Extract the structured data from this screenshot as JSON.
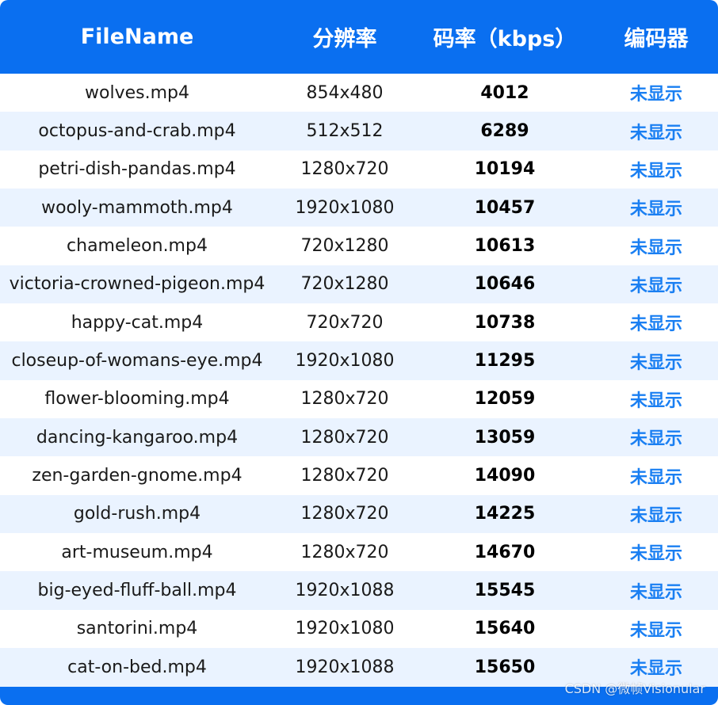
{
  "table": {
    "headers": [
      "FileName",
      "分辨率",
      "码率（kbps）",
      "编码器"
    ],
    "rows": [
      {
        "filename": "wolves.mp4",
        "resolution": "854x480",
        "bitrate": "4012",
        "codec": "未显示"
      },
      {
        "filename": "octopus-and-crab.mp4",
        "resolution": "512x512",
        "bitrate": "6289",
        "codec": "未显示"
      },
      {
        "filename": "petri-dish-pandas.mp4",
        "resolution": "1280x720",
        "bitrate": "10194",
        "codec": "未显示"
      },
      {
        "filename": "wooly-mammoth.mp4",
        "resolution": "1920x1080",
        "bitrate": "10457",
        "codec": "未显示"
      },
      {
        "filename": "chameleon.mp4",
        "resolution": "720x1280",
        "bitrate": "10613",
        "codec": "未显示"
      },
      {
        "filename": "victoria-crowned-pigeon.mp4",
        "resolution": "720x1280",
        "bitrate": "10646",
        "codec": "未显示"
      },
      {
        "filename": "happy-cat.mp4",
        "resolution": "720x720",
        "bitrate": "10738",
        "codec": "未显示"
      },
      {
        "filename": "closeup-of-womans-eye.mp4",
        "resolution": "1920x1080",
        "bitrate": "11295",
        "codec": "未显示"
      },
      {
        "filename": "flower-blooming.mp4",
        "resolution": "1280x720",
        "bitrate": "12059",
        "codec": "未显示"
      },
      {
        "filename": "dancing-kangaroo.mp4",
        "resolution": "1280x720",
        "bitrate": "13059",
        "codec": "未显示"
      },
      {
        "filename": "zen-garden-gnome.mp4",
        "resolution": "1280x720",
        "bitrate": "14090",
        "codec": "未显示"
      },
      {
        "filename": "gold-rush.mp4",
        "resolution": "1280x720",
        "bitrate": "14225",
        "codec": "未显示"
      },
      {
        "filename": "art-museum.mp4",
        "resolution": "1280x720",
        "bitrate": "14670",
        "codec": "未显示"
      },
      {
        "filename": "big-eyed-fluff-ball.mp4",
        "resolution": "1920x1088",
        "bitrate": "15545",
        "codec": "未显示"
      },
      {
        "filename": "santorini.mp4",
        "resolution": "1920x1080",
        "bitrate": "15640",
        "codec": "未显示"
      },
      {
        "filename": "cat-on-bed.mp4",
        "resolution": "1920x1088",
        "bitrate": "15650",
        "codec": "未显示"
      }
    ]
  },
  "watermark": "CSDN @微帧Visionular",
  "colors": {
    "header_bg": "#0a6ff0",
    "alt_row_bg": "#eaf3ff",
    "codec_text": "#1a7ff2"
  }
}
